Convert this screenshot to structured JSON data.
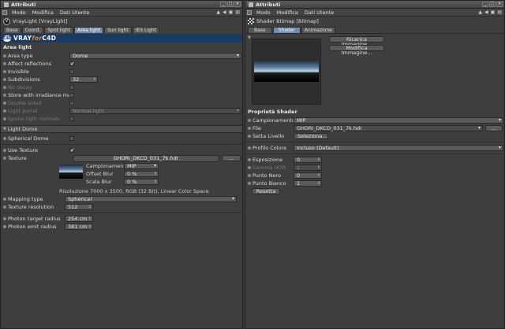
{
  "left": {
    "title": "Attributi",
    "menu": [
      "Modo",
      "Modifica",
      "Dati Utente"
    ],
    "object": "VrayLight [VrayLight]",
    "tabs": [
      "Base",
      "Coord.",
      "Spot light",
      "Area light",
      "Sun light",
      "IES Light"
    ],
    "active_tab": "Area light",
    "banner": {
      "vray": "VRAY",
      "for": "for",
      "c4d": "C4D"
    },
    "section": "Area light",
    "area_type": {
      "label": "Area type",
      "value": "Dome"
    },
    "affect_reflections": "Affect reflections",
    "invisible": "Invisible",
    "subdivisions": {
      "label": "Subdivisions",
      "value": "32"
    },
    "no_decay": "No decay",
    "store_irradiance": "Store with irradiance map",
    "double_sided": "Double sided",
    "light_portal": {
      "label": "Light portal",
      "value": "Normal light"
    },
    "ignore_normals": "Ignore light normals",
    "light_dome": "Light Dome",
    "spherical_dome": "Spherical Dome",
    "use_texture": "Use Texture",
    "texture": {
      "label": "Texture",
      "file": "GHDRI_DKCD_031_7k.hdr",
      "browse": "..."
    },
    "campionamento": {
      "label": "Campionamento",
      "value": "MIP"
    },
    "offset_blur": {
      "label": "Offset Blur",
      "value": "0 %"
    },
    "scala_blur": {
      "label": "Scala Blur",
      "value": "0 %"
    },
    "resolution": "Risoluzione 7000 x 3500, RGB (32 Bit), Linear Color Space",
    "mapping_type": {
      "label": "Mapping type",
      "value": "Spherical"
    },
    "texture_resolution": {
      "label": "Texture resolution",
      "value": "512"
    },
    "photon_target": {
      "label": "Photon target radius",
      "value": "254 cm"
    },
    "photon_emit": {
      "label": "Photon emit radius",
      "value": "381 cm"
    }
  },
  "right": {
    "title": "Attributi",
    "menu": [
      "Modo",
      "Modifica",
      "Dati Utente"
    ],
    "object": "Shader Bitmap [Bitmap]",
    "tabs": [
      "Base",
      "Shader",
      "Animazione"
    ],
    "active_tab": "Shader",
    "reload": "Ricarica Immagine...",
    "edit": "Modifica Immagine...",
    "section": "Proprietà Shader",
    "campionamento": {
      "label": "Campionamento",
      "value": "MIP"
    },
    "file": {
      "label": "File",
      "value": "GHDRI_DKCD_031_7k.hdr",
      "browse": "..."
    },
    "setta_livello": {
      "label": "Setta Livello",
      "button": "Seleziona..."
    },
    "profilo_colore": {
      "label": "Profilo Colore",
      "value": "Incluso (Default)"
    },
    "esposizione": {
      "label": "Esposizione",
      "value": "0"
    },
    "gamma_hdr": {
      "label": "Gamma HDR",
      "value": "1"
    },
    "punto_nero": {
      "label": "Punto Nero",
      "value": "0"
    },
    "punto_bianco": {
      "label": "Punto Bianco",
      "value": "1"
    },
    "resetta": "Resetta"
  },
  "icons": [
    "attribute-icon",
    "checkmark-icon",
    "dropdown-arrow-icon",
    "stepper-icon",
    "minimize-icon",
    "maximize-icon",
    "close-icon"
  ]
}
